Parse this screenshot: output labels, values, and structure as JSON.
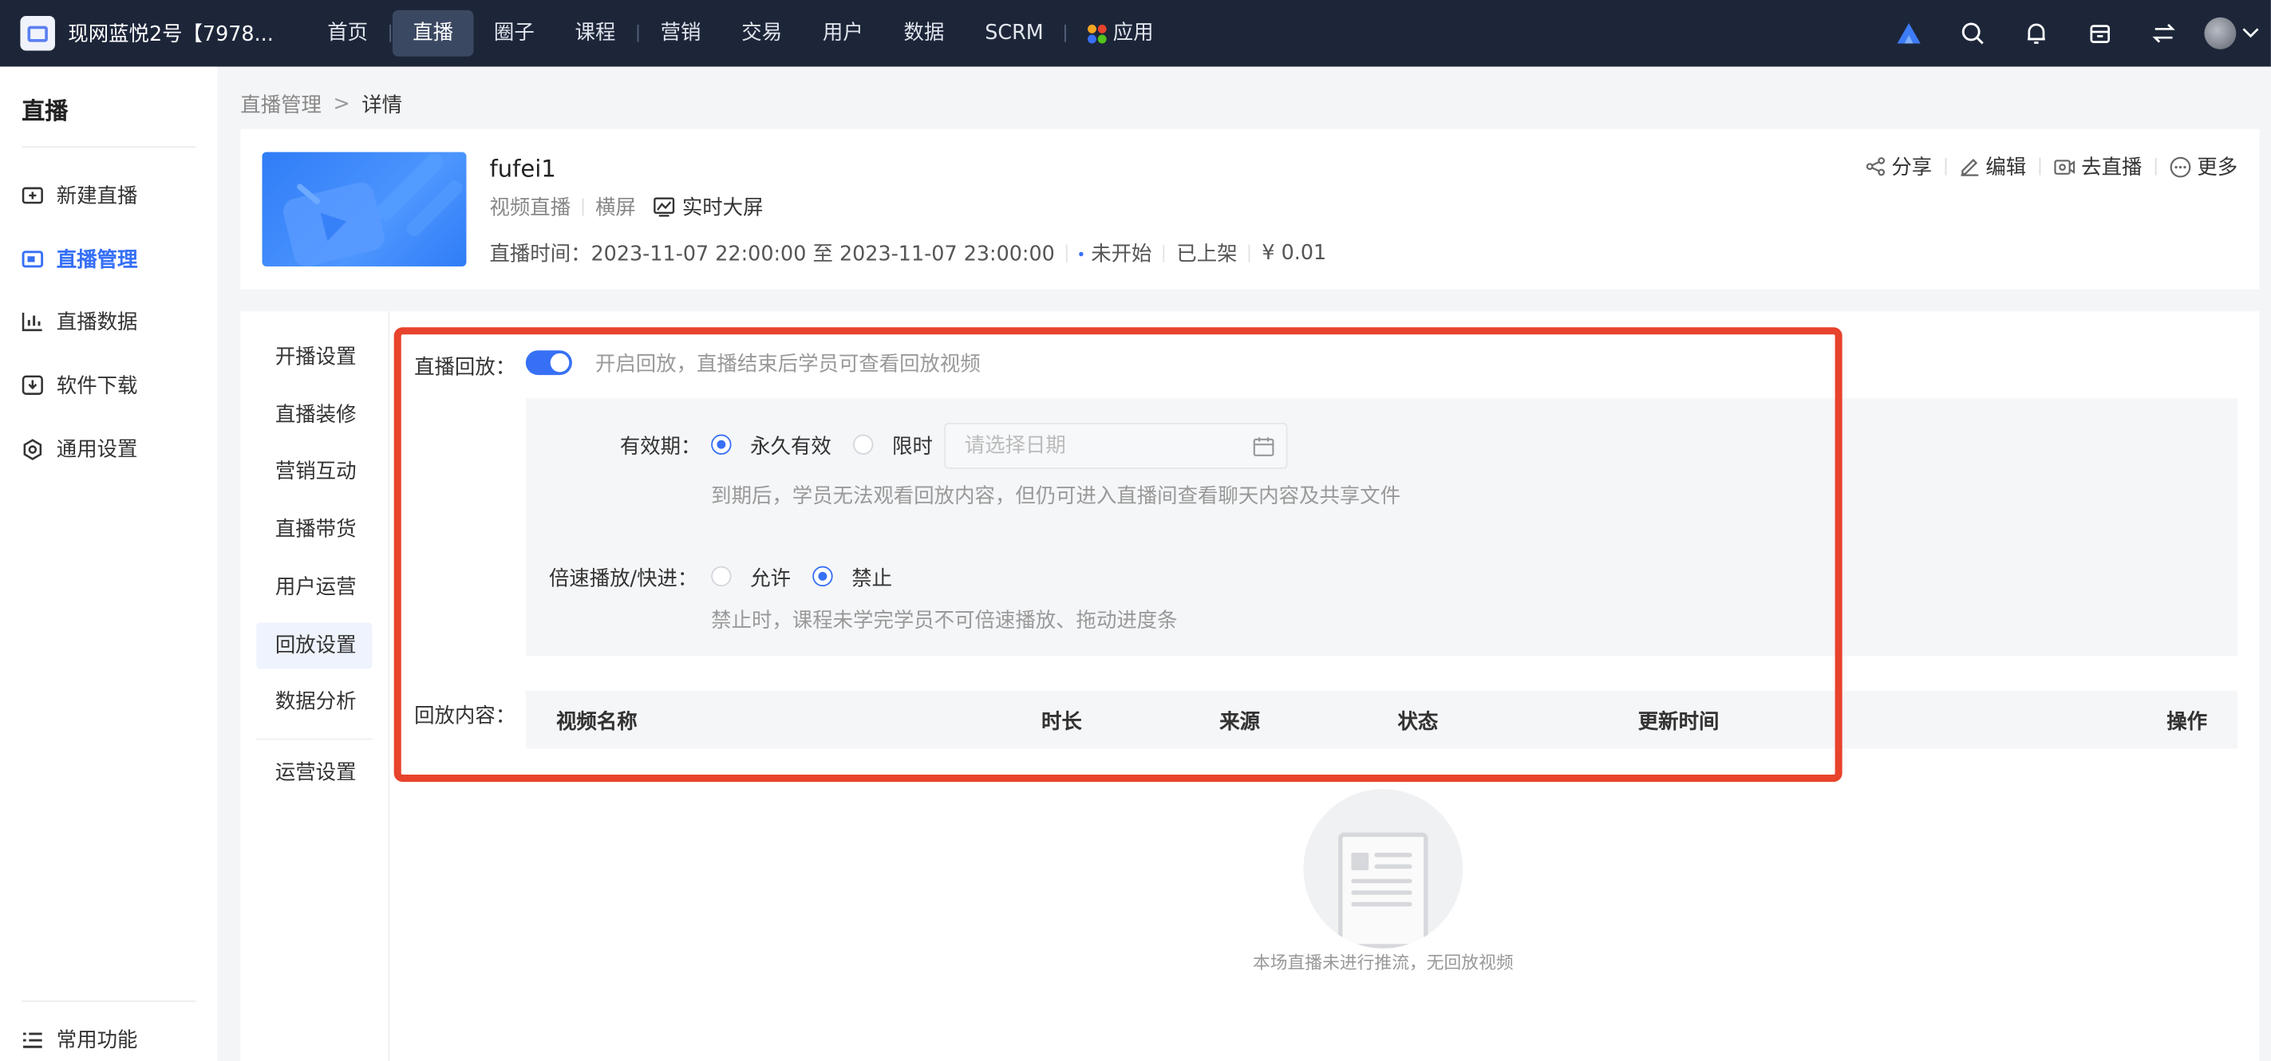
{
  "topnav": {
    "shop_name": "现网蓝悦2号【7978...",
    "items": [
      "首页",
      "直播",
      "圈子",
      "课程",
      "营销",
      "交易",
      "用户",
      "数据",
      "SCRM",
      "应用"
    ],
    "active": "直播"
  },
  "sidebar": {
    "title": "直播",
    "items": [
      {
        "label": "新建直播",
        "icon": "video-plus-icon"
      },
      {
        "label": "直播管理",
        "icon": "live-manage-icon",
        "active": true
      },
      {
        "label": "直播数据",
        "icon": "bar-chart-icon"
      },
      {
        "label": "软件下载",
        "icon": "download-icon"
      },
      {
        "label": "通用设置",
        "icon": "gear-icon"
      }
    ],
    "bottom_item": {
      "label": "常用功能",
      "icon": "list-icon"
    }
  },
  "breadcrumb": {
    "parent": "直播管理",
    "separator": ">",
    "current": "详情"
  },
  "live": {
    "title": "fufei1",
    "type": "视频直播",
    "orientation": "横屏",
    "screen_link": "实时大屏",
    "time_label": "直播时间：",
    "time_range": "2023-11-07 22:00:00 至 2023-11-07 23:00:00",
    "status": "未开始",
    "shelf_status": "已上架",
    "price": "¥ 0.01"
  },
  "actions": [
    "分享",
    "编辑",
    "去直播",
    "更多"
  ],
  "sub_nav": {
    "items": [
      "开播设置",
      "直播装修",
      "营销互动",
      "直播带货",
      "用户运营",
      "回放设置",
      "数据分析"
    ],
    "active": "回放设置",
    "after_divider": "运营设置"
  },
  "replay": {
    "label": "直播回放：",
    "enabled": true,
    "enabled_hint": "开启回放，直播结束后学员可查看回放视频",
    "validity_label": "有效期：",
    "validity_options": [
      "永久有效",
      "限时"
    ],
    "validity_selected": "永久有效",
    "date_placeholder": "请选择日期",
    "validity_hint": "到期后，学员无法观看回放内容，但仍可进入直播间查看聊天内容及共享文件",
    "speed_label": "倍速播放/快进：",
    "speed_options": [
      "允许",
      "禁止"
    ],
    "speed_selected": "禁止",
    "speed_hint": "禁止时，课程未学完学员不可倍速播放、拖动进度条",
    "content_label": "回放内容：",
    "table_columns": [
      "视频名称",
      "时长",
      "来源",
      "状态",
      "更新时间",
      "操作"
    ],
    "empty_text": "本场直播未进行推流，无回放视频"
  },
  "colors": {
    "accent": "#3770f5",
    "nav_bg": "#1d2639",
    "highlight_border": "#e8432c"
  }
}
